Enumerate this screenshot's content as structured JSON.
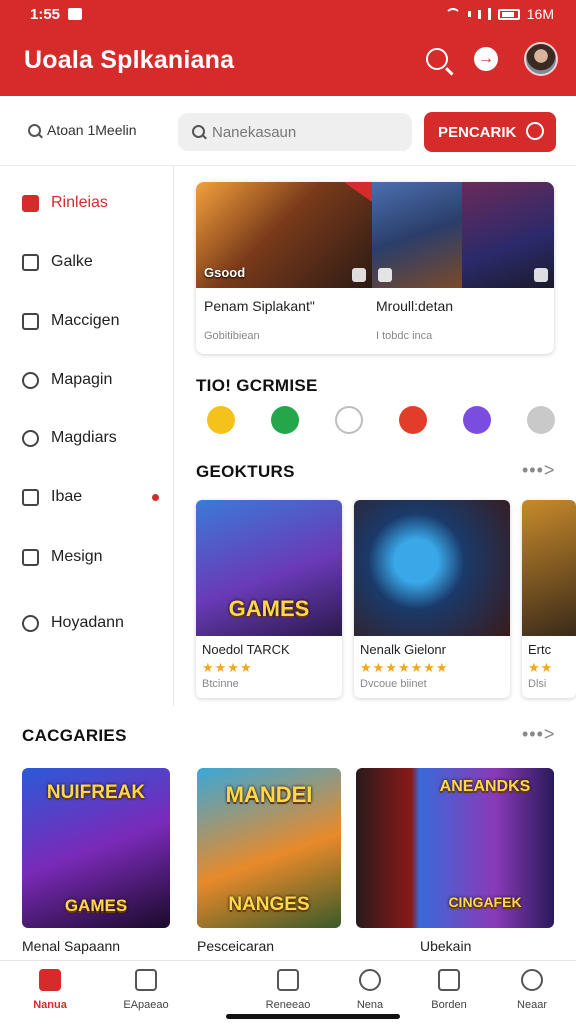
{
  "status": {
    "time": "1:55",
    "right_text": "16M"
  },
  "app": {
    "title": "Uoala Splkaniana"
  },
  "search": {
    "breadcrumb": "Atoan 1Meelin",
    "placeholder": "Nanekasaun",
    "button_label": "PENCARIK"
  },
  "sidebar": {
    "items": [
      {
        "label": "Rinleias",
        "icon": "mail-icon",
        "active": true
      },
      {
        "label": "Galke",
        "icon": "calendar-icon"
      },
      {
        "label": "Maccigen",
        "icon": "message-icon"
      },
      {
        "label": "Mapagin",
        "icon": "map-icon"
      },
      {
        "label": "Magdiars",
        "icon": "circle-icon"
      },
      {
        "label": "Ibae",
        "icon": "square-icon",
        "dot": true
      },
      {
        "label": "Mesign",
        "icon": "image-icon"
      },
      {
        "label": "Hoyadann",
        "icon": "tag-icon"
      }
    ]
  },
  "featured": {
    "image_tag": "Gsood",
    "items": [
      {
        "title": "Penam Siplakant\"",
        "sub": "Gobitibiean"
      },
      {
        "title": "Mroull:detan",
        "sub": "I tobdc inca"
      }
    ]
  },
  "top_games": {
    "title": "TIO! GCRMISE",
    "icons": [
      {
        "name": "yellow-game-icon",
        "color": "#f5c21b"
      },
      {
        "name": "green-game-icon",
        "color": "#23a74a"
      },
      {
        "name": "chat-game-icon",
        "color": "#bdbdbd"
      },
      {
        "name": "red-game-icon",
        "color": "#e23c2b"
      },
      {
        "name": "purple-game-icon",
        "color": "#7a4de0"
      },
      {
        "name": "gray-game-icon",
        "color": "#c9c9c9"
      }
    ]
  },
  "geokturs": {
    "title": "GEOKTURS",
    "more": "•••>",
    "cards": [
      {
        "name": "Noedol TARCK",
        "stars": "★★★★",
        "meta": "Btcinne",
        "word": "GAMES"
      },
      {
        "name": "Nenalk Gielonr",
        "stars": "★★★★★★★",
        "meta": "Dvcoue biinet",
        "word": ""
      },
      {
        "name": "Ertc",
        "stars": "★★",
        "meta": "Dlsi",
        "word": ""
      }
    ]
  },
  "categories": {
    "title": "CACGARIES",
    "more": "•••>",
    "cards": [
      {
        "name": "Menal Sapaann",
        "top_word": "NUIFREAK",
        "bottom_word": "GAMES"
      },
      {
        "name": "Pesceicaran",
        "top_word": "MANDEI",
        "bottom_word": "NANGES"
      },
      {
        "name": "Ubekain",
        "top_word": "ANEANDKS",
        "bottom_word": "CINGAFEK"
      }
    ]
  },
  "bottom_nav": [
    {
      "label": "Nanua",
      "active": true,
      "icon": "home-icon"
    },
    {
      "label": "EApaeao",
      "icon": "store-icon"
    },
    {
      "label": "Reneeao",
      "icon": "bag-icon"
    },
    {
      "label": "Nena",
      "icon": "search-icon"
    },
    {
      "label": "Borden",
      "icon": "list-icon"
    },
    {
      "label": "Neaar",
      "icon": "profile-icon"
    }
  ]
}
